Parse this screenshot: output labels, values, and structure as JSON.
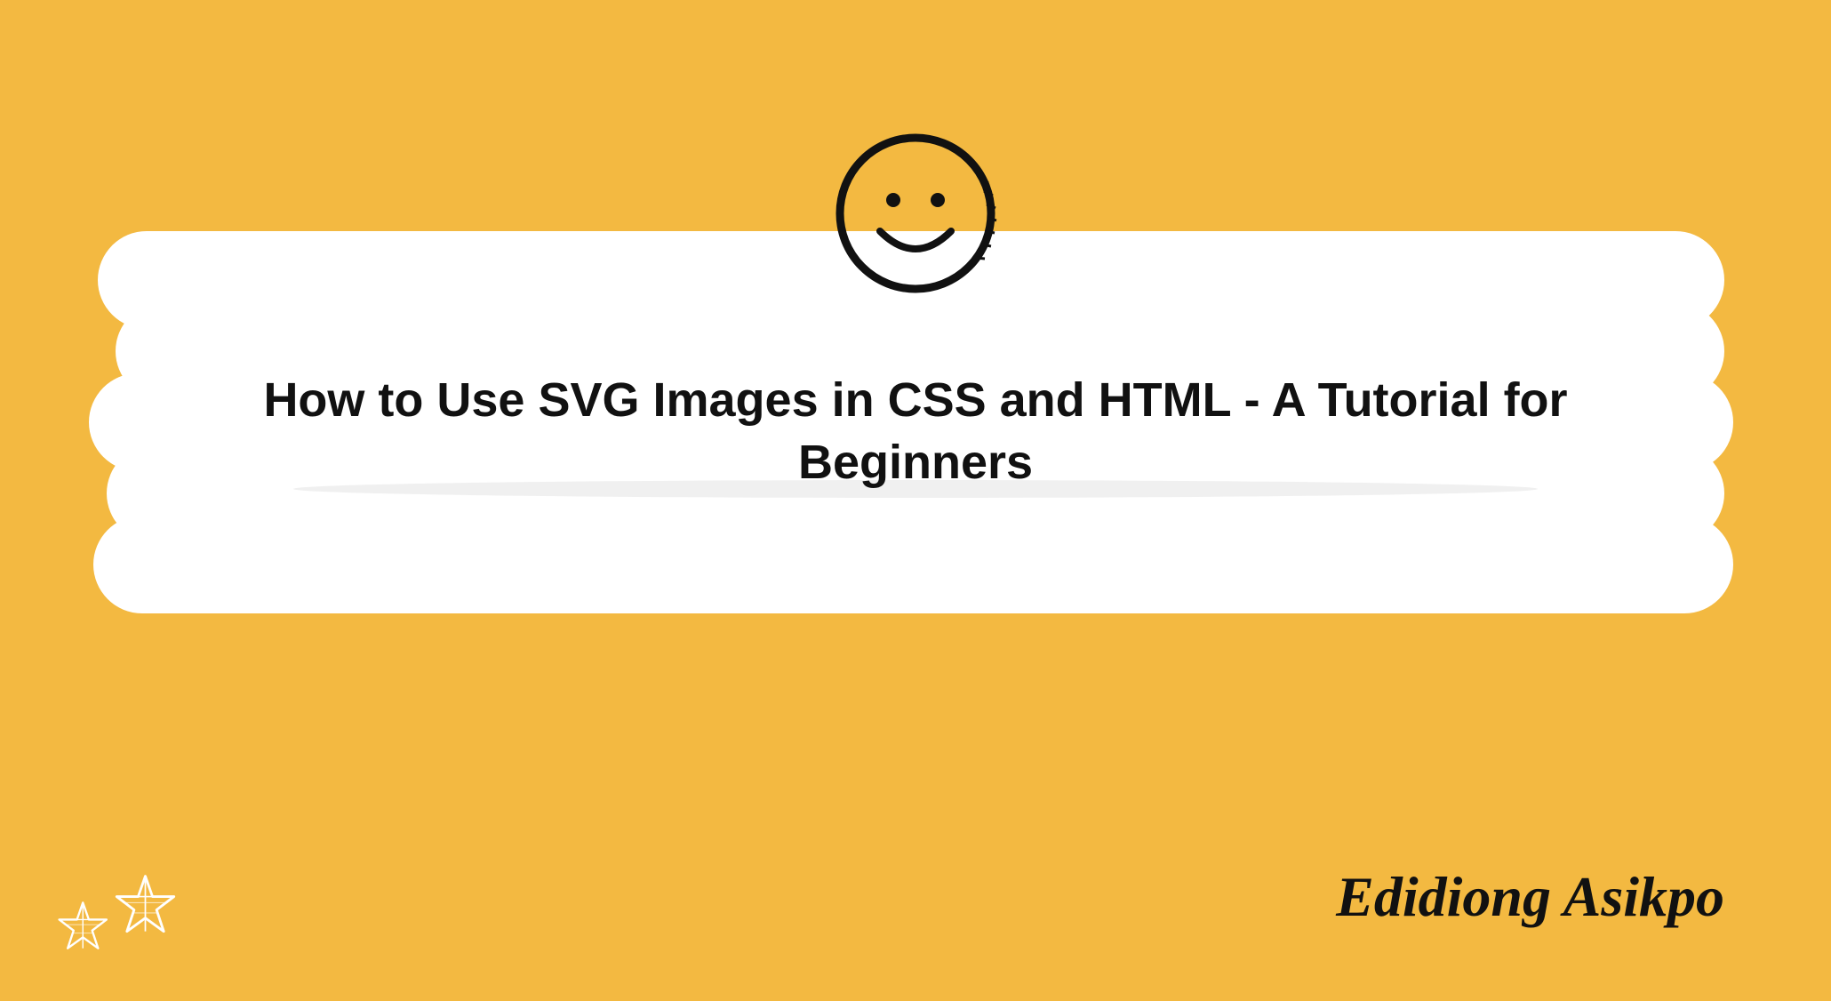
{
  "headline": "How to Use SVG Images in CSS and HTML - A Tutorial for Beginners",
  "author": "Edidiong Asikpo",
  "icons": {
    "smiley": "smiley-face",
    "stars": "two-stars"
  },
  "colors": {
    "background": "#f3b941",
    "panel": "#ffffff",
    "text": "#111111"
  }
}
